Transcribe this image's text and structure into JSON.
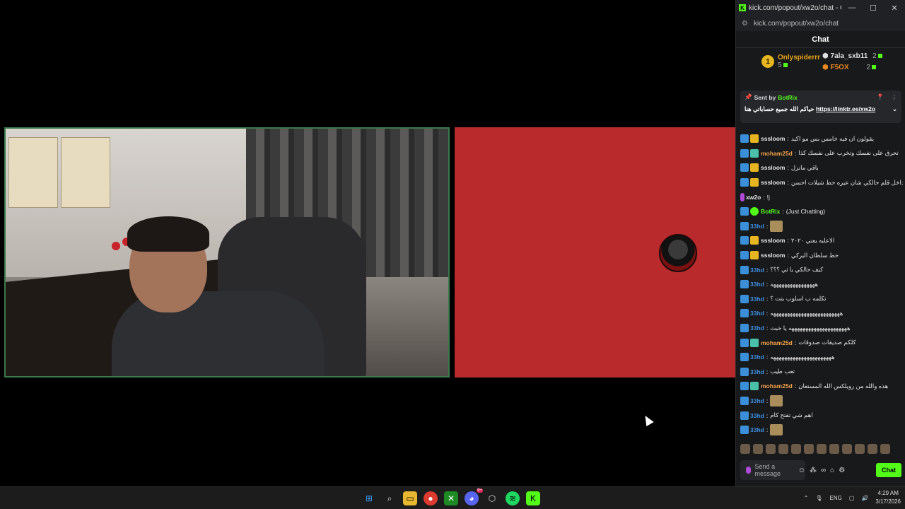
{
  "browser": {
    "title": "kick.com/popout/xw2o/chat - Goo...",
    "url": "kick.com/popout/xw2o/chat",
    "minimize": "—",
    "maximize": "☐",
    "close": "✕"
  },
  "chat": {
    "header": "Chat",
    "leaderboard": {
      "first": {
        "rank": "1",
        "name": "Onlyspiderrr",
        "count": "5"
      },
      "second": {
        "name": "7ala_sxb11",
        "count": "2"
      },
      "third": {
        "name": "F5OX",
        "count": "2"
      }
    },
    "pinned": {
      "sent_by_label": "Sent by",
      "sender": "BotRix",
      "text": "حياكم الله جميع حساباتي هنا",
      "link": "https://linktr.ee/xw2o"
    },
    "messages": [
      {
        "user": "sssloom",
        "color": "#e8e8e8",
        "text": "يقولون ان فيه خامس بس مو اكيد",
        "badge": "gold"
      },
      {
        "user": "moham25d",
        "color": "#f2a14a",
        "text": "تحرق على نفسك وتخرب على نفسك كذا",
        "badge": "teal"
      },
      {
        "user": "sssloom",
        "color": "#e8e8e8",
        "text": "باقي مانزل",
        "badge": "gold"
      },
      {
        "user": "sssloom",
        "color": "#e8e8e8",
        "text": "حب داخل قلم حالكي شان عيره حط شيلات احسن",
        "badge": "gold"
      },
      {
        "user": "xw2o",
        "color": "#e8e8e8",
        "text": "!j",
        "badge": "mic"
      },
      {
        "user": "BotRix",
        "color": "#53fc18",
        "text": "(Just Chatting)",
        "badge": "bot"
      },
      {
        "user": "33hd",
        "color": "#3d8fe0",
        "text": "",
        "badge": "none",
        "emote": true
      },
      {
        "user": "sssloom",
        "color": "#e8e8e8",
        "text": "الاعلبه يعني ٢٠٢٠",
        "badge": "gold"
      },
      {
        "user": "sssloom",
        "color": "#e8e8e8",
        "text": "حط سلطان البركي",
        "badge": "gold"
      },
      {
        "user": "33hd",
        "color": "#3d8fe0",
        "text": "كيف حالكي يا ثي ؟؟؟",
        "badge": "none"
      },
      {
        "user": "33hd",
        "color": "#3d8fe0",
        "text": "ههههههههههههههههه",
        "badge": "none"
      },
      {
        "user": "33hd",
        "color": "#3d8fe0",
        "text": "تكلمه ب اسلوب بنت ؟",
        "badge": "none"
      },
      {
        "user": "33hd",
        "color": "#3d8fe0",
        "text": "هههههههههههههههههههههههههه",
        "badge": "none"
      },
      {
        "user": "33hd",
        "color": "#3d8fe0",
        "text": "هههههههههههههههههههههه يا خبث",
        "badge": "none"
      },
      {
        "user": "moham25d",
        "color": "#f2a14a",
        "text": "كلكم صديقات صدوقات",
        "badge": "teal"
      },
      {
        "user": "33hd",
        "color": "#3d8fe0",
        "text": "ههههههههههههههههههههههه",
        "badge": "none"
      },
      {
        "user": "33hd",
        "color": "#3d8fe0",
        "text": "تعب طيب",
        "badge": "none"
      },
      {
        "user": "moham25d",
        "color": "#f2a14a",
        "text": "هذه والله من رويلكس الله المستعان",
        "badge": "teal"
      },
      {
        "user": "33hd",
        "color": "#3d8fe0",
        "text": "",
        "badge": "none",
        "emote": true
      },
      {
        "user": "33hd",
        "color": "#3d8fe0",
        "text": "اهم شي تفتح كام",
        "badge": "none"
      },
      {
        "user": "33hd",
        "color": "#3d8fe0",
        "text": "",
        "badge": "none",
        "emote": true
      }
    ],
    "input_placeholder": "Send a message",
    "send_label": "Chat"
  },
  "taskbar": {
    "language": "ENG",
    "time": "4:29 AM",
    "date": "3/17/2026",
    "discord_badge": "9+"
  }
}
